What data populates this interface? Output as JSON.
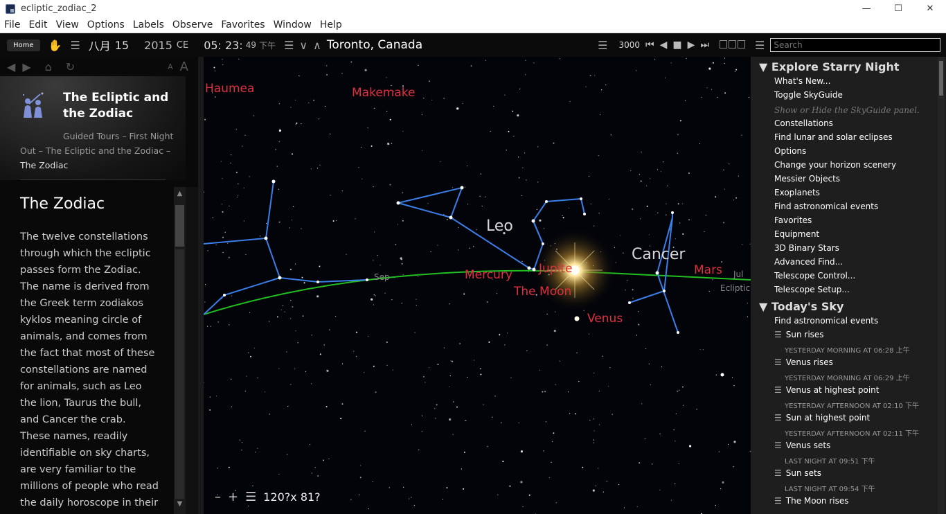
{
  "window": {
    "title": "ecliptic_zodiac_2",
    "minimize": "—",
    "maximize": "☐",
    "close": "✕"
  },
  "menu": [
    "File",
    "Edit",
    "View",
    "Options",
    "Labels",
    "Observe",
    "Favorites",
    "Window",
    "Help"
  ],
  "toolbar": {
    "home": "Home",
    "month": "八月",
    "day": "15",
    "year": "2015",
    "era": "CE",
    "time": "05: 23:",
    "seconds": "49",
    "ampm": "下午",
    "location": "Toronto, Canada",
    "time_rate": "3000",
    "icons": [
      "hand-icon",
      "menu-icon",
      "chevron-down-icon",
      "chevron-up-icon",
      "skip-back-icon",
      "step-back-icon",
      "stop-icon",
      "play-icon",
      "skip-forward-icon"
    ]
  },
  "left_panel": {
    "title": "The Ecliptic and the Zodiac",
    "breadcrumb_1": "Guided Tours – First Night Out – The Ecliptic and the Zodiac – ",
    "breadcrumb_current": "The Zodiac",
    "heading": "The Zodiac",
    "body": "The twelve constellations through which the ecliptic passes form the Zodiac. The name is derived from the Greek term zodiakos kyklos meaning circle of animals, and comes from the fact that most of these constellations are named for animals, such as Leo the lion, Taurus the bull, and Cancer the crab. These names, readily identifiable on sky charts, are very familiar to the millions of people who read the daily horoscope in their",
    "font_small": "A",
    "font_large": "A"
  },
  "sky": {
    "labels": {
      "haumea": "Haumea",
      "makemake": "Makemake",
      "mercury": "Mercury",
      "jupiter": "Jupite",
      "moon": "The Moon",
      "venus": "Venus",
      "mars": "Mars"
    },
    "constellations": {
      "leo": "Leo",
      "cancer": "Cancer"
    },
    "small": {
      "sep": "Sep",
      "jul": "Jul",
      "ecliptic": "Ecliptic"
    },
    "fov": "120?x 81?",
    "ecliptic_color": "#22c020",
    "line_color": "#3a7ee8",
    "label_color": "#e03040"
  },
  "right_panel": {
    "search_placeholder": "Search",
    "section1": "Explore Starry Night",
    "items1": [
      "What's New...",
      "Toggle SkyGuide"
    ],
    "note": "Show or Hide the SkyGuide panel.",
    "items2": [
      "Constellations",
      "Find lunar and solar eclipses",
      "Options",
      "Change your horizon scenery",
      "Messier Objects",
      "Exoplanets",
      "Find astronomical events",
      "Favorites",
      "Equipment",
      "3D Binary Stars",
      "Advanced Find...",
      "Telescope Control...",
      "Telescope Setup..."
    ],
    "section2": "Today's Sky",
    "find_events": "Find astronomical events",
    "events": [
      {
        "name": "Sun rises",
        "when": "YESTERDAY MORNING AT 06:28 上午"
      },
      {
        "name": "Venus rises",
        "when": "YESTERDAY MORNING AT 06:29 上午"
      },
      {
        "name": "Venus at highest point",
        "when": "YESTERDAY AFTERNOON AT 02:10 下午"
      },
      {
        "name": "Sun at highest point",
        "when": "YESTERDAY AFTERNOON AT 02:11 下午"
      },
      {
        "name": "Venus sets",
        "when": "LAST NIGHT AT 09:51 下午"
      },
      {
        "name": "Sun sets",
        "when": "LAST NIGHT AT 09:54 下午"
      },
      {
        "name": "The Moon rises",
        "when": ""
      }
    ]
  }
}
